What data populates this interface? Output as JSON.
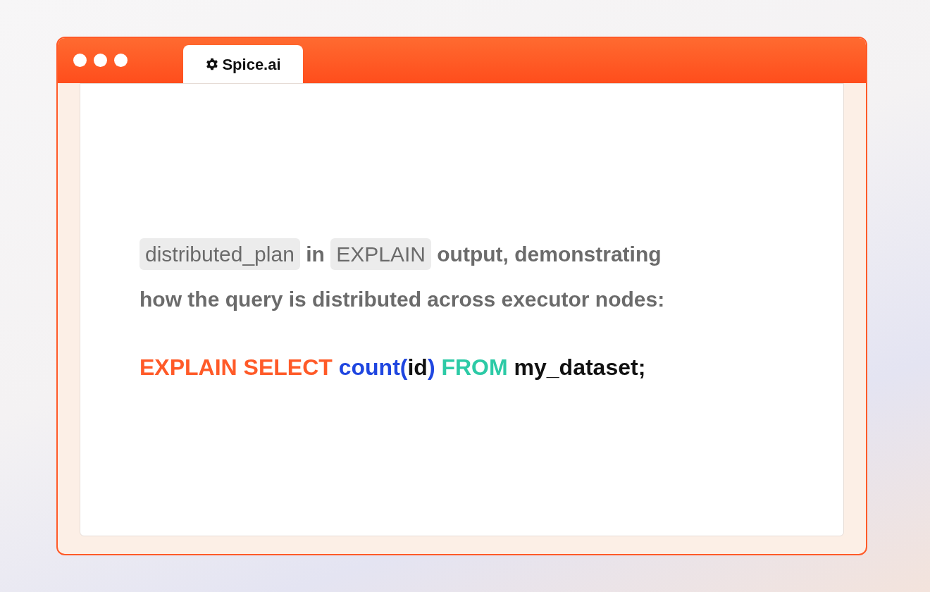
{
  "window": {
    "controls": [
      {
        "kind": "dot"
      },
      {
        "kind": "dot"
      },
      {
        "kind": "dot"
      }
    ]
  },
  "tabs": [
    {
      "label": "Spice.ai",
      "selected": true
    }
  ],
  "description": {
    "lines": [
      [
        {
          "kind": "code",
          "text": "distributed_plan"
        },
        {
          "kind": "text",
          "text": "in"
        },
        {
          "kind": "code",
          "text": "EXPLAIN"
        },
        {
          "kind": "text",
          "text": "output, demonstrating"
        }
      ],
      [
        {
          "kind": "text",
          "text": "how the query is distributed across executor nodes:"
        }
      ]
    ]
  },
  "code": {
    "words": [
      [
        {
          "text": "EXPLAIN SELECT",
          "color": "#ff5a28"
        }
      ],
      [
        {
          "text": "count",
          "color": "#1f46e0"
        },
        {
          "text": "(",
          "color": "#1f46e0"
        },
        {
          "text": "id",
          "color": "#111111"
        },
        {
          "text": ")",
          "color": "#1f46e0"
        }
      ],
      [
        {
          "text": "FROM",
          "color": "#2ccaa6"
        }
      ],
      [
        {
          "text": "my_dataset;",
          "color": "#111111"
        }
      ]
    ]
  }
}
